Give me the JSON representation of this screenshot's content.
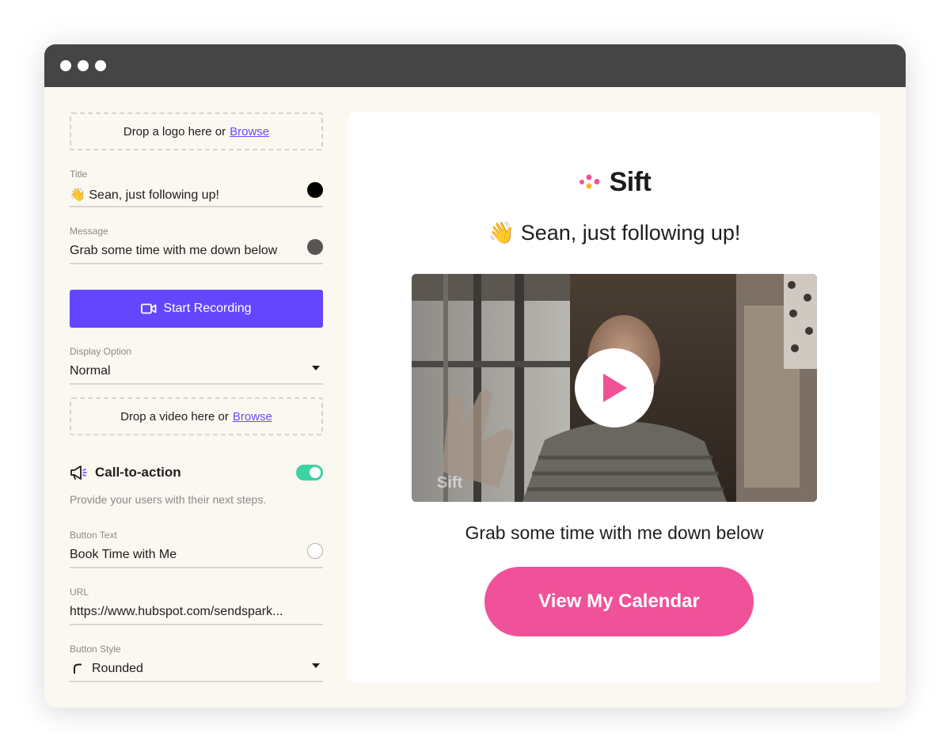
{
  "window": {
    "dots": [
      "close",
      "minimize",
      "maximize"
    ]
  },
  "editor": {
    "logo_drop": {
      "text": "Drop a logo here or",
      "link": "Browse"
    },
    "title_field": {
      "label": "Title",
      "value": "👋 Sean, just following up!",
      "color": "#000000"
    },
    "message_field": {
      "label": "Message",
      "value": "Grab some time with me down below",
      "color": "#5a5552"
    },
    "record_button": {
      "label": "Start Recording",
      "icon": "video-camera-icon"
    },
    "display_option": {
      "label": "Display Option",
      "value": "Normal"
    },
    "video_drop": {
      "text": "Drop a video here or",
      "link": "Browse"
    },
    "cta": {
      "title": "Call-to-action",
      "icon": "megaphone-icon",
      "enabled": true,
      "description": "Provide your users with their next steps."
    },
    "button_text_field": {
      "label": "Button Text",
      "value": "Book Time with Me",
      "color": "#ffffff"
    },
    "url_field": {
      "label": "URL",
      "value": "https://www.hubspot.com/sendspark..."
    },
    "button_style": {
      "label": "Button Style",
      "value": "Rounded",
      "icon": "rounded-corner-icon"
    }
  },
  "preview": {
    "brand": "Sift",
    "title": "👋 Sean, just following up!",
    "video_watermark": "Sift",
    "message": "Grab some time with me down below",
    "button_label": "View My Calendar"
  },
  "colors": {
    "accent_purple": "#6446ff",
    "link_purple": "#6b4bff",
    "toggle_green": "#3ed1a4",
    "cta_pink": "#ef5298",
    "panel_bg": "#fbf8f1",
    "titlebar": "#454545"
  }
}
